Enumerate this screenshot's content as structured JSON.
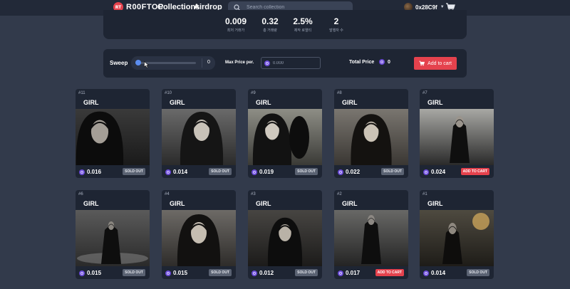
{
  "header": {
    "brand": "R00FTOP",
    "logo_text": "RT",
    "nav": [
      "Collections",
      "Airdrop"
    ],
    "search_placeholder": "Search collection",
    "wallet_address": "0x28C9f"
  },
  "stats": [
    {
      "value": "0.009",
      "label": "최저 거래가"
    },
    {
      "value": "0.32",
      "label": "총 거래량"
    },
    {
      "value": "2.5%",
      "label": "제작 로열티"
    },
    {
      "value": "2",
      "label": "발행자 수"
    }
  ],
  "sweep": {
    "label": "Sweep",
    "value": "0",
    "fraction": 0,
    "max_price_label": "Max Price per.",
    "max_price_placeholder": "0.000",
    "total_label": "Total Price",
    "total_value": "0",
    "add_to_cart_label": "Add to cart"
  },
  "colors": {
    "background": "#323a4b",
    "panel": "#1e2533",
    "accent_red": "#e5424d",
    "token_purple": "#6b4bd8"
  },
  "cards": [
    {
      "num": "#11",
      "name": "GIRL",
      "price": "0.016",
      "status": "SOLD OUT",
      "sold": true
    },
    {
      "num": "#10",
      "name": "GIRL",
      "price": "0.014",
      "status": "SOLD OUT",
      "sold": true
    },
    {
      "num": "#9",
      "name": "GIRL",
      "price": "0.019",
      "status": "SOLD OUT",
      "sold": true
    },
    {
      "num": "#8",
      "name": "GIRL",
      "price": "0.022",
      "status": "SOLD OUT",
      "sold": true
    },
    {
      "num": "#7",
      "name": "GIRL",
      "price": "0.024",
      "status": "ADD TO CART",
      "sold": false
    },
    {
      "num": "#6",
      "name": "GIRL",
      "price": "0.015",
      "status": "SOLD OUT",
      "sold": true
    },
    {
      "num": "#4",
      "name": "GIRL",
      "price": "0.015",
      "status": "SOLD OUT",
      "sold": true
    },
    {
      "num": "#3",
      "name": "GIRL",
      "price": "0.012",
      "status": "SOLD OUT",
      "sold": true
    },
    {
      "num": "#2",
      "name": "GIRL",
      "price": "0.017",
      "status": "ADD TO CART",
      "sold": false
    },
    {
      "num": "#1",
      "name": "GIRL",
      "price": "0.014",
      "status": "SOLD OUT",
      "sold": true
    }
  ]
}
